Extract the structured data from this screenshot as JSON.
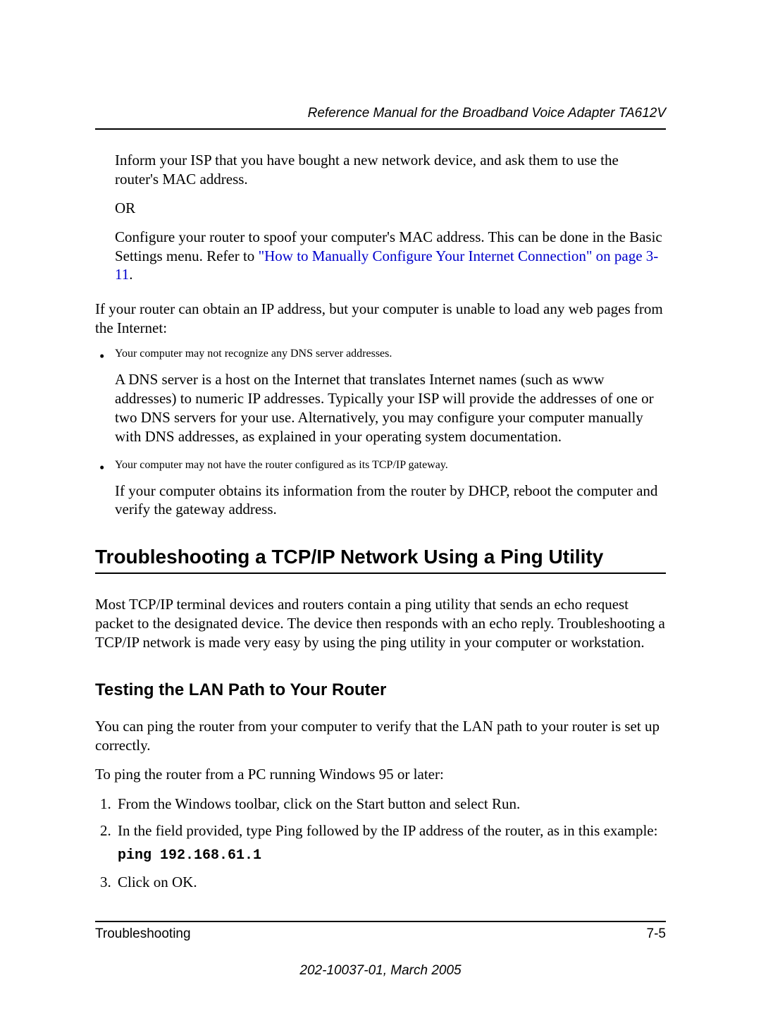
{
  "header": {
    "title": "Reference Manual for the Broadband Voice Adapter TA612V"
  },
  "body": {
    "para1": "Inform your ISP that you have bought a new network device, and ask them to use the router's MAC address.",
    "or": "OR",
    "para2_pre": "Configure your router to spoof your computer's MAC address. This can be done in the Basic Settings menu. Refer to ",
    "para2_link": "\"How to Manually Configure Your Internet Connection\" on page 3-11",
    "para2_post": ".",
    "para3": "If your router can obtain an IP address, but your computer is unable to load any web pages from the Internet:",
    "bullet1": "Your computer may not recognize any DNS server addresses.",
    "bullet1_detail": "A DNS server is a host on the Internet that translates Internet names (such as www addresses) to numeric IP addresses. Typically your ISP will provide the addresses of one or two DNS servers for your use. Alternatively, you may configure your computer manually with DNS addresses, as explained in your operating system documentation.",
    "bullet2": "Your computer may not have the router configured as its TCP/IP gateway.",
    "bullet2_detail": "If your computer obtains its information from the router by DHCP, reboot the computer and verify the gateway address."
  },
  "section": {
    "heading": "Troubleshooting a TCP/IP Network Using a Ping Utility",
    "intro": "Most TCP/IP terminal devices and routers contain a ping utility that sends an echo request packet to the designated device. The device then responds with an echo reply. Troubleshooting a TCP/IP network is made very easy by using the ping utility in your computer or workstation."
  },
  "subsection": {
    "heading": "Testing the LAN Path to Your Router",
    "para1": "You can ping the router from your computer to verify that the LAN path to your router is set up correctly.",
    "para2": "To ping the router from a PC running Windows 95 or later:",
    "steps": {
      "s1": "From the Windows toolbar, click on the Start button and select Run.",
      "s2": "In the field provided, type Ping followed by the IP address of the router, as in this example:",
      "s2_code": "ping 192.168.61.1",
      "s3": "Click on OK."
    }
  },
  "footer": {
    "left": "Troubleshooting",
    "right": "7-5",
    "docid": "202-10037-01, March 2005"
  }
}
